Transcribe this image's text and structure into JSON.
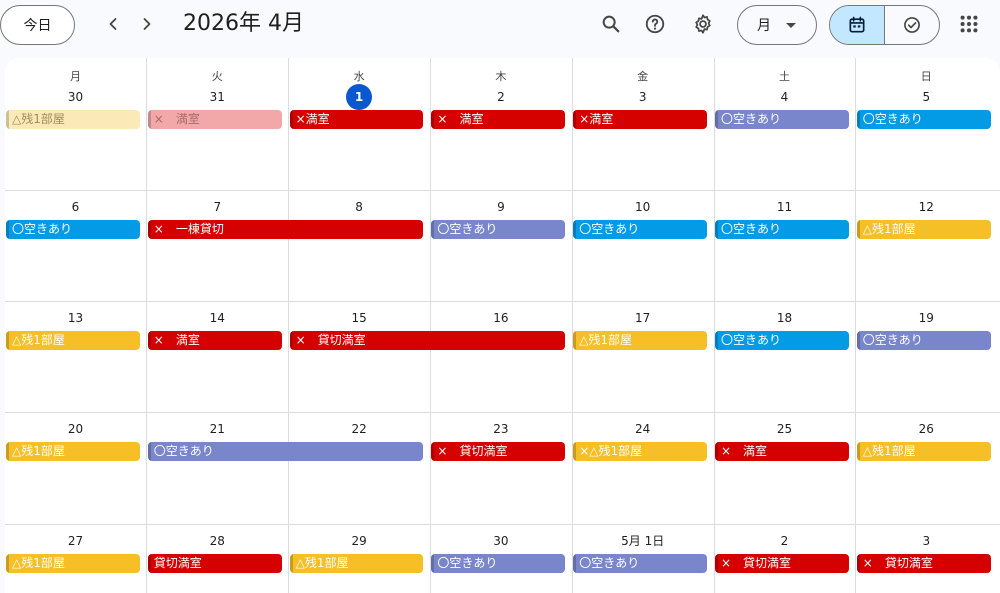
{
  "toolbar": {
    "today_label": "今日",
    "prev_icon": "chevron-left-icon",
    "next_icon": "chevron-right-icon",
    "title": "2026年 4月",
    "view_label": "月",
    "search_icon": "search-icon",
    "help_icon": "help-icon",
    "settings_icon": "gear-icon",
    "calendar_view_icon": "calendar-icon",
    "tasks_view_icon": "check-circle-icon",
    "apps_icon": "apps-grid-icon"
  },
  "colors": {
    "red": "#d50000",
    "red_faded": "#f2a8a8",
    "yellow": "#f6bf26",
    "yellow_faded": "#fbe9b8",
    "blue": "#039be5",
    "lavender": "#7986cb",
    "today": "#0b57d0"
  },
  "weekdays": [
    "月",
    "火",
    "水",
    "木",
    "金",
    "土",
    "日"
  ],
  "weeks": [
    {
      "days": [
        "30",
        "31",
        "1",
        "2",
        "3",
        "4",
        "5"
      ],
      "today_index": 2,
      "events": [
        {
          "col": 0,
          "span": 1,
          "label": "△残1部屋",
          "color": "yellow_faded",
          "text": "#9e8e5a"
        },
        {
          "col": 1,
          "span": 1,
          "label": "×　満室",
          "color": "red_faded",
          "text": "#a86b6b"
        },
        {
          "col": 2,
          "span": 1,
          "label": "×満室",
          "color": "red"
        },
        {
          "col": 3,
          "span": 1,
          "label": "×　満室",
          "color": "red"
        },
        {
          "col": 4,
          "span": 1,
          "label": "×満室",
          "color": "red"
        },
        {
          "col": 5,
          "span": 1,
          "label": "〇空きあり",
          "color": "lavender"
        },
        {
          "col": 6,
          "span": 1,
          "label": "〇空きあり",
          "color": "blue"
        }
      ]
    },
    {
      "days": [
        "6",
        "7",
        "8",
        "9",
        "10",
        "11",
        "12"
      ],
      "today_index": -1,
      "events": [
        {
          "col": 0,
          "span": 1,
          "label": "〇空きあり",
          "color": "blue"
        },
        {
          "col": 1,
          "span": 2,
          "label": "×　一棟貸切",
          "color": "red"
        },
        {
          "col": 3,
          "span": 1,
          "label": "〇空きあり",
          "color": "lavender"
        },
        {
          "col": 4,
          "span": 1,
          "label": "〇空きあり",
          "color": "blue"
        },
        {
          "col": 5,
          "span": 1,
          "label": "〇空きあり",
          "color": "blue"
        },
        {
          "col": 6,
          "span": 1,
          "label": "△残1部屋",
          "color": "yellow"
        }
      ]
    },
    {
      "days": [
        "13",
        "14",
        "15",
        "16",
        "17",
        "18",
        "19"
      ],
      "today_index": -1,
      "events": [
        {
          "col": 0,
          "span": 1,
          "label": "△残1部屋",
          "color": "yellow"
        },
        {
          "col": 1,
          "span": 1,
          "label": "×　満室",
          "color": "red"
        },
        {
          "col": 2,
          "span": 2,
          "label": "×　貸切満室",
          "color": "red"
        },
        {
          "col": 4,
          "span": 1,
          "label": "△残1部屋",
          "color": "yellow"
        },
        {
          "col": 5,
          "span": 1,
          "label": "〇空きあり",
          "color": "blue"
        },
        {
          "col": 6,
          "span": 1,
          "label": "〇空きあり",
          "color": "lavender"
        }
      ]
    },
    {
      "days": [
        "20",
        "21",
        "22",
        "23",
        "24",
        "25",
        "26"
      ],
      "today_index": -1,
      "events": [
        {
          "col": 0,
          "span": 1,
          "label": "△残1部屋",
          "color": "yellow"
        },
        {
          "col": 1,
          "span": 2,
          "label": "〇空きあり",
          "color": "lavender"
        },
        {
          "col": 3,
          "span": 1,
          "label": "×　貸切満室",
          "color": "red"
        },
        {
          "col": 4,
          "span": 1,
          "label": "×△残1部屋",
          "color": "yellow"
        },
        {
          "col": 5,
          "span": 1,
          "label": "×　満室",
          "color": "red"
        },
        {
          "col": 6,
          "span": 1,
          "label": "△残1部屋",
          "color": "yellow"
        }
      ]
    },
    {
      "days": [
        "27",
        "28",
        "29",
        "30",
        "5月 1日",
        "2",
        "3"
      ],
      "today_index": -1,
      "events": [
        {
          "col": 0,
          "span": 1,
          "label": "△残1部屋",
          "color": "yellow"
        },
        {
          "col": 1,
          "span": 1,
          "label": "貸切満室",
          "color": "red"
        },
        {
          "col": 2,
          "span": 1,
          "label": "△残1部屋",
          "color": "yellow"
        },
        {
          "col": 3,
          "span": 1,
          "label": "〇空きあり",
          "color": "lavender"
        },
        {
          "col": 4,
          "span": 1,
          "label": "〇空きあり",
          "color": "lavender"
        },
        {
          "col": 5,
          "span": 1,
          "label": "×　貸切満室",
          "color": "red"
        },
        {
          "col": 6,
          "span": 1,
          "label": "×　貸切満室",
          "color": "red"
        }
      ]
    }
  ]
}
